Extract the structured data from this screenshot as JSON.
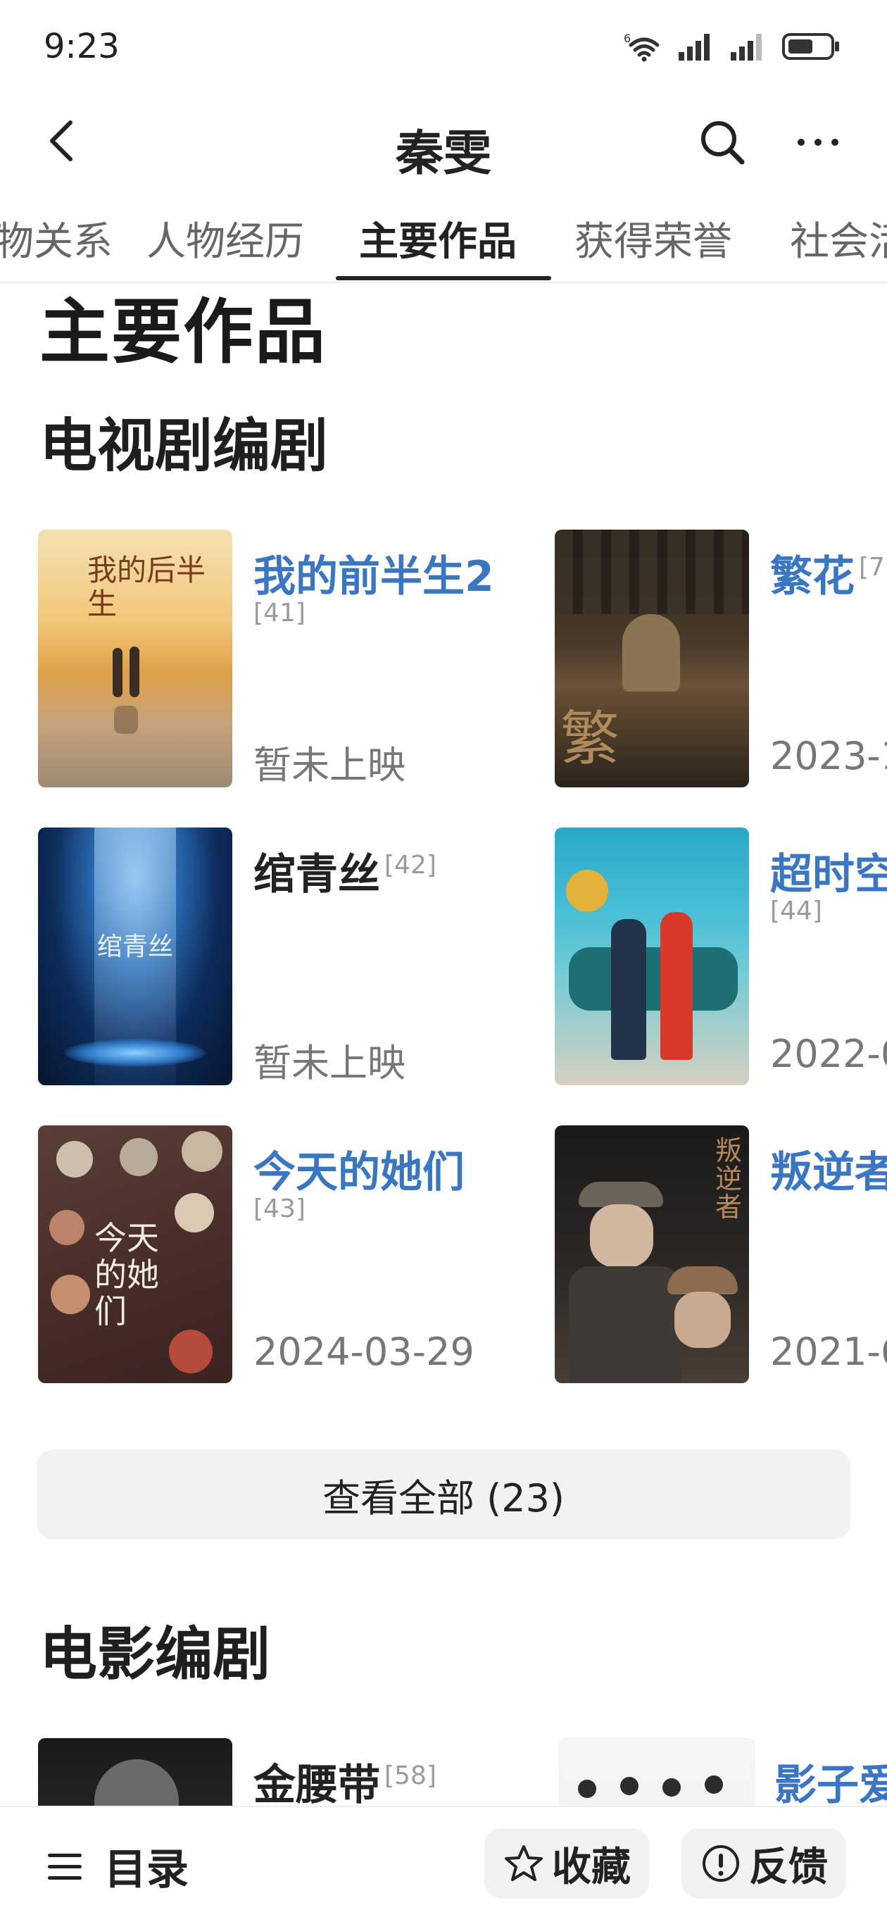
{
  "status": {
    "time": "9:23",
    "network": "6"
  },
  "nav": {
    "title": "秦雯"
  },
  "tabs": [
    {
      "label": "物关系"
    },
    {
      "label": "人物经历"
    },
    {
      "label": "主要作品"
    },
    {
      "label": "获得荣誉"
    },
    {
      "label": "社会活"
    }
  ],
  "section": {
    "title": "主要作品"
  },
  "tv": {
    "heading": "电视剧编剧",
    "works": [
      {
        "title": "我的前半生2",
        "ref": "[41]",
        "date": "暂未上映",
        "link": true,
        "poster_text": "我的后半生"
      },
      {
        "title": "繁花",
        "ref": "[7",
        "date": "2023-1",
        "link": true,
        "poster_text": "繁花"
      },
      {
        "title": "绾青丝",
        "ref": "[42]",
        "date": "暂未上映",
        "link": false,
        "poster_text": "绾青丝"
      },
      {
        "title": "超时空",
        "ref": "[44]",
        "date": "2022-0",
        "link": true,
        "poster_text": ""
      },
      {
        "title": "今天的她们",
        "ref": "[43]",
        "date": "2024-03-29",
        "link": true,
        "poster_text": "今天的她们"
      },
      {
        "title": "叛逆者",
        "ref": "",
        "date": "2021-6",
        "link": true,
        "poster_text": "叛逆者"
      }
    ],
    "view_all": "查看全部 (23)"
  },
  "film": {
    "heading": "电影编剧",
    "works": [
      {
        "title": "金腰带",
        "ref": "[58]",
        "link": false
      },
      {
        "title": "影子爱",
        "ref": "",
        "link": true
      }
    ]
  },
  "bottom": {
    "toc_label": "目录",
    "favorite_label": "收藏",
    "feedback_label": "反馈"
  }
}
